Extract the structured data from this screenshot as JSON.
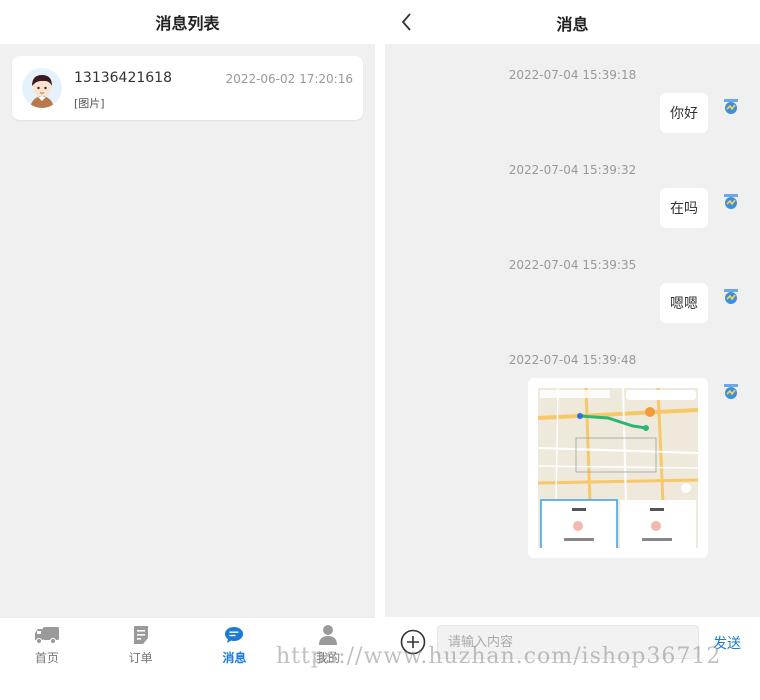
{
  "left_panel": {
    "title": "消息列表",
    "conversation": {
      "name": "13136421618",
      "time": "2022-06-02 17:20:16",
      "preview": "[图片]"
    },
    "tabs": [
      {
        "label": "首页",
        "icon": "truck-icon",
        "active": false
      },
      {
        "label": "订单",
        "icon": "document-icon",
        "active": false
      },
      {
        "label": "消息",
        "icon": "chat-bubble-icon",
        "active": true
      },
      {
        "label": "我的",
        "icon": "user-icon",
        "active": false
      }
    ]
  },
  "chat": {
    "title": "消息",
    "messages": [
      {
        "time": "2022-07-04 15:39:18",
        "text": "你好"
      },
      {
        "time": "2022-07-04 15:39:32",
        "text": "在吗"
      },
      {
        "time": "2022-07-04 15:39:35",
        "text": "嗯嗯"
      },
      {
        "time": "2022-07-04 15:39:48",
        "image": "map-screenshot"
      }
    ],
    "input_placeholder": "请输入内容",
    "send_label": "发送"
  },
  "watermark": "https://www.huzhan.com/ishop36712",
  "colors": {
    "accent": "#1a7bd8",
    "background": "#f0f0f0"
  }
}
